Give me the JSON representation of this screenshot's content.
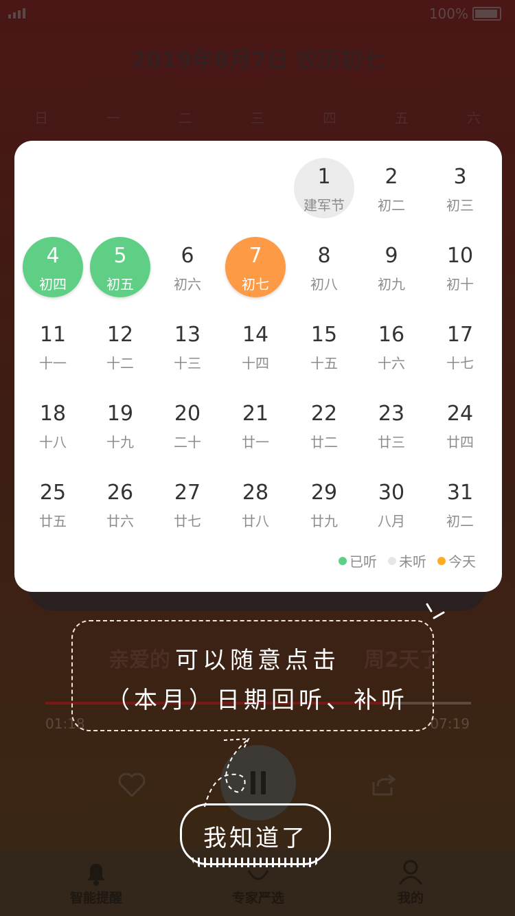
{
  "status": {
    "battery_text": "100%"
  },
  "header": {
    "title": "2019年8月7日 农历初七"
  },
  "weekdays": [
    "日",
    "一",
    "二",
    "三",
    "四",
    "五",
    "六"
  ],
  "calendar": {
    "days": [
      {
        "num": "1",
        "lunar": "建军节",
        "state": "unheard"
      },
      {
        "num": "2",
        "lunar": "初二",
        "state": ""
      },
      {
        "num": "3",
        "lunar": "初三",
        "state": ""
      },
      {
        "num": "4",
        "lunar": "初四",
        "state": "heard"
      },
      {
        "num": "5",
        "lunar": "初五",
        "state": "heard"
      },
      {
        "num": "6",
        "lunar": "初六",
        "state": ""
      },
      {
        "num": "7",
        "lunar": "初七",
        "state": "today"
      },
      {
        "num": "8",
        "lunar": "初八",
        "state": ""
      },
      {
        "num": "9",
        "lunar": "初九",
        "state": ""
      },
      {
        "num": "10",
        "lunar": "初十",
        "state": ""
      },
      {
        "num": "11",
        "lunar": "十一",
        "state": ""
      },
      {
        "num": "12",
        "lunar": "十二",
        "state": ""
      },
      {
        "num": "13",
        "lunar": "十三",
        "state": ""
      },
      {
        "num": "14",
        "lunar": "十四",
        "state": ""
      },
      {
        "num": "15",
        "lunar": "十五",
        "state": ""
      },
      {
        "num": "16",
        "lunar": "十六",
        "state": ""
      },
      {
        "num": "17",
        "lunar": "十七",
        "state": ""
      },
      {
        "num": "18",
        "lunar": "十八",
        "state": ""
      },
      {
        "num": "19",
        "lunar": "十九",
        "state": ""
      },
      {
        "num": "20",
        "lunar": "二十",
        "state": ""
      },
      {
        "num": "21",
        "lunar": "廿一",
        "state": ""
      },
      {
        "num": "22",
        "lunar": "廿二",
        "state": ""
      },
      {
        "num": "23",
        "lunar": "廿三",
        "state": ""
      },
      {
        "num": "24",
        "lunar": "廿四",
        "state": ""
      },
      {
        "num": "25",
        "lunar": "廿五",
        "state": ""
      },
      {
        "num": "26",
        "lunar": "廿六",
        "state": ""
      },
      {
        "num": "27",
        "lunar": "廿七",
        "state": ""
      },
      {
        "num": "28",
        "lunar": "廿八",
        "state": ""
      },
      {
        "num": "29",
        "lunar": "廿九",
        "state": ""
      },
      {
        "num": "30",
        "lunar": "八月",
        "state": ""
      },
      {
        "num": "31",
        "lunar": "初二",
        "state": ""
      }
    ],
    "legend": [
      {
        "label": "已听",
        "color": "#5fcf85"
      },
      {
        "label": "未听",
        "color": "#e6e6e6"
      },
      {
        "label": "今天",
        "color": "#fcae23"
      }
    ]
  },
  "player": {
    "episode_text": "亲爱的",
    "episode_text_tail": "周2天了",
    "time_current": "01:18",
    "time_total": "07:19",
    "progress": 0.81
  },
  "guide": {
    "line1": "可以随意点击",
    "line2": "（本月）日期回听、补听",
    "ok_label": "我知道了"
  },
  "tabbar": {
    "items": [
      {
        "label": "智能提醒",
        "icon": "bell-icon"
      },
      {
        "label": "专家严选",
        "icon": "expert-icon"
      },
      {
        "label": "我的",
        "icon": "user-icon"
      }
    ]
  },
  "colors": {
    "heard": "#5fcf85",
    "today": "#fd9a45",
    "unheard": "#ebebeb"
  }
}
